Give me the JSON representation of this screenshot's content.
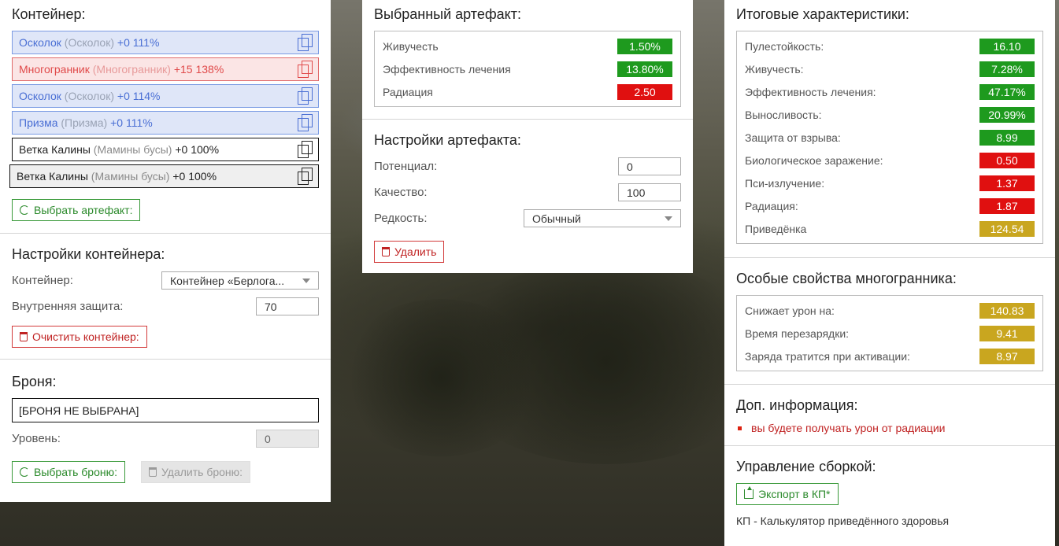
{
  "container_section": {
    "title": "Контейнер:",
    "artifacts": [
      {
        "name": "Осколок",
        "sub": "(Осколок)",
        "bonus": "+0 111%",
        "style": "blue"
      },
      {
        "name": "Многогранник",
        "sub": "(Многогранник)",
        "bonus": "+15 138%",
        "style": "red"
      },
      {
        "name": "Осколок",
        "sub": "(Осколок)",
        "bonus": "+0 114%",
        "style": "blue"
      },
      {
        "name": "Призма",
        "sub": "(Призма)",
        "bonus": "+0 111%",
        "style": "blue"
      },
      {
        "name": "Ветка Калины",
        "sub": "(Мамины бусы)",
        "bonus": "+0 100%",
        "style": "plain"
      },
      {
        "name": "Ветка Калины",
        "sub": "(Мамины бусы)",
        "bonus": "+0 100%",
        "style": "gray"
      }
    ],
    "select_button": "Выбрать артефакт:"
  },
  "container_settings": {
    "title": "Настройки контейнера:",
    "container_label": "Контейнер:",
    "container_value": "Контейнер «Берлога...",
    "protection_label": "Внутренняя защита:",
    "protection_value": "70",
    "clear_button": "Очистить контейнер:"
  },
  "armor": {
    "title": "Броня:",
    "value": "[БРОНЯ НЕ ВЫБРАНА]",
    "level_label": "Уровень:",
    "level_value": "0",
    "select_button": "Выбрать броню:",
    "delete_button": "Удалить броню:"
  },
  "selected_artifact": {
    "title": "Выбранный артефакт:",
    "stats": [
      {
        "label": "Живучесть",
        "value": "1.50%",
        "color": "green"
      },
      {
        "label": "Эффективность лечения",
        "value": "13.80%",
        "color": "green"
      },
      {
        "label": "Радиация",
        "value": "2.50",
        "color": "red"
      }
    ]
  },
  "artifact_settings": {
    "title": "Настройки артефакта:",
    "potential_label": "Потенциал:",
    "potential_value": "0",
    "quality_label": "Качество:",
    "quality_value": "100",
    "rarity_label": "Редкость:",
    "rarity_value": "Обычный",
    "delete_button": "Удалить"
  },
  "totals": {
    "title": "Итоговые характеристики:",
    "stats": [
      {
        "label": "Пулестойкость:",
        "value": "16.10",
        "color": "green"
      },
      {
        "label": "Живучесть:",
        "value": "7.28%",
        "color": "green"
      },
      {
        "label": "Эффективность лечения:",
        "value": "47.17%",
        "color": "green"
      },
      {
        "label": "Выносливость:",
        "value": "20.99%",
        "color": "green"
      },
      {
        "label": "Защита от взрыва:",
        "value": "8.99",
        "color": "green"
      },
      {
        "label": "Биологическое заражение:",
        "value": "0.50",
        "color": "red"
      },
      {
        "label": "Пси-излучение:",
        "value": "1.37",
        "color": "red"
      },
      {
        "label": "Радиация:",
        "value": "1.87",
        "color": "red"
      },
      {
        "label": "Приведёнка",
        "value": "124.54",
        "color": "gold"
      }
    ]
  },
  "special": {
    "title": "Особые свойства многогранника:",
    "stats": [
      {
        "label": "Снижает урон на:",
        "value": "140.83",
        "color": "gold"
      },
      {
        "label": "Время перезарядки:",
        "value": "9.41",
        "color": "gold"
      },
      {
        "label": "Заряда тратится при активации:",
        "value": "8.97",
        "color": "gold"
      }
    ]
  },
  "extra_info": {
    "title": "Доп. информация:",
    "items": [
      "вы будете получать урон от радиации"
    ]
  },
  "build": {
    "title": "Управление сборкой:",
    "export_button": "Экспорт в КП*",
    "note": "КП - Калькулятор приведённого здоровья"
  },
  "colors": {
    "green": "#1e9a1e",
    "red": "#e01010",
    "gold": "#c9a61f"
  }
}
